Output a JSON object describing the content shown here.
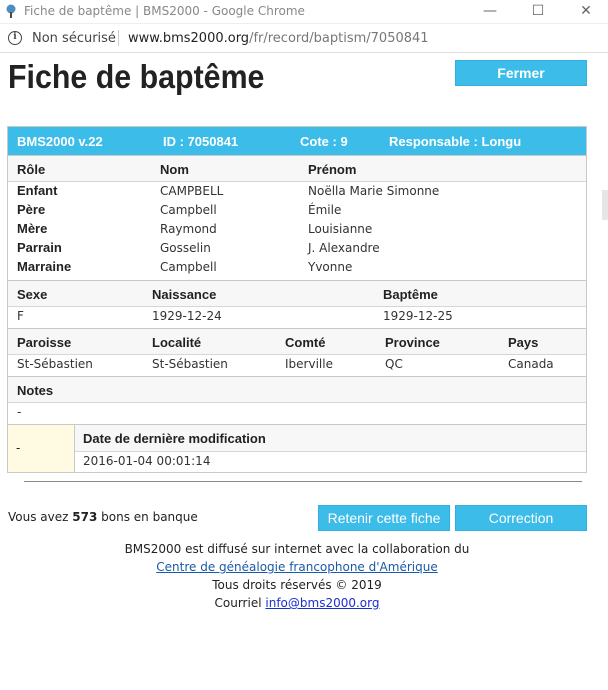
{
  "window": {
    "title": "Fiche de baptême | BMS2000 - Google Chrome",
    "min_glyph": "—",
    "max_glyph": "☐",
    "close_glyph": "✕",
    "app_icon": "tree-icon"
  },
  "address_bar": {
    "info_glyph": "i",
    "security_label": "Non sécurisé",
    "url_host": "www.bms2000.org",
    "url_path": "/fr/record/baptism/7050841"
  },
  "page": {
    "title": "Fiche de baptême",
    "close_button": "Fermer"
  },
  "record": {
    "header": {
      "version": "BMS2000 v.22",
      "id": "ID : 7050841",
      "cote": "Cote : 9",
      "responsable": "Responsable : Longu"
    },
    "persons_header": {
      "role": "Rôle",
      "nom": "Nom",
      "prenom": "Prénom"
    },
    "persons": [
      {
        "role": "Enfant",
        "nom": "CAMPBELL",
        "prenom": "Noëlla Marie Simonne"
      },
      {
        "role": "Père",
        "nom": "Campbell",
        "prenom": "Émile"
      },
      {
        "role": "Mère",
        "nom": "Raymond",
        "prenom": "Louisianne"
      },
      {
        "role": "Parrain",
        "nom": "Gosselin",
        "prenom": "J. Alexandre"
      },
      {
        "role": "Marraine",
        "nom": "Campbell",
        "prenom": "Yvonne"
      }
    ],
    "birth_header": {
      "sexe": "Sexe",
      "naissance": "Naissance",
      "bapteme": "Baptême"
    },
    "birth": {
      "sexe": "F",
      "naissance": "1929-12-24",
      "bapteme": "1929-12-25"
    },
    "place_header": {
      "paroisse": "Paroisse",
      "localite": "Localité",
      "comte": "Comté",
      "province": "Province",
      "pays": "Pays"
    },
    "place": {
      "paroisse": "St-Sébastien",
      "localite": "St-Sébastien",
      "comte": "Iberville",
      "province": "QC",
      "pays": "Canada"
    },
    "notes_header": "Notes",
    "notes": "-",
    "modif_left": "-",
    "modif_header": "Date de dernière modification",
    "modif_value": "2016-01-04 00:01:14"
  },
  "balance": {
    "prefix": "Vous avez",
    "count": "573",
    "suffix": "bons en banque"
  },
  "buttons": {
    "keep": "Retenir cette fiche",
    "correction": "Correction"
  },
  "footer": {
    "line1": "BMS2000 est diffusé sur internet avec la collaboration du",
    "link": "Centre de généalogie francophone d'Amérique",
    "rights": "Tous droits réservés © 2019",
    "mail_label": "Courriel",
    "mail": "info@bms2000.org"
  },
  "colors": {
    "accent": "#3cbce8",
    "header_bg": "#f7f7f7",
    "modif_bg": "#fffbe3"
  }
}
